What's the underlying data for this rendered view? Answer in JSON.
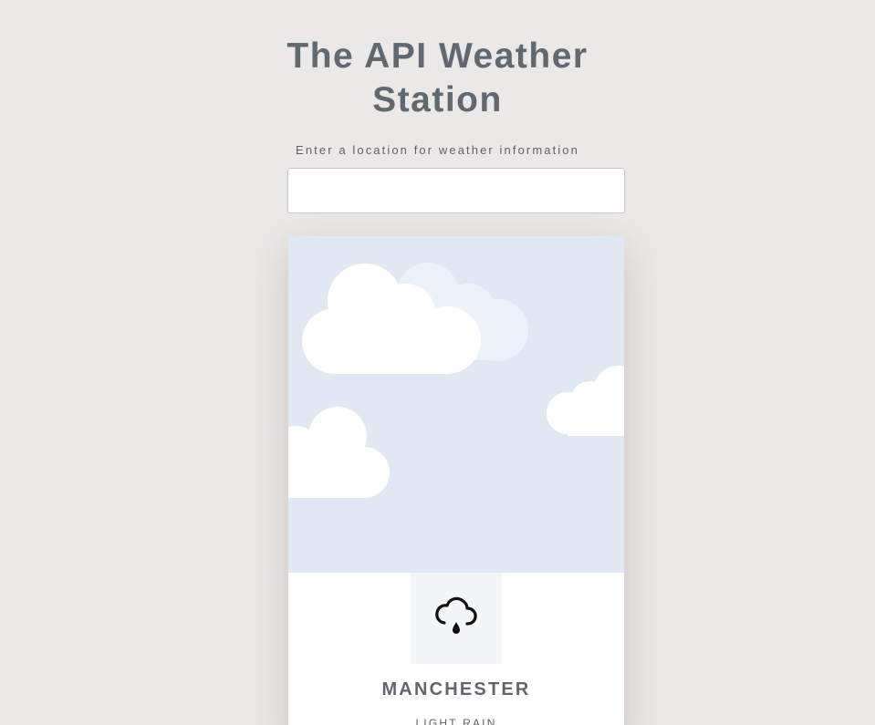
{
  "header": {
    "title_line1": "The API Weather",
    "title_line2": "Station",
    "prompt": "Enter a location for weather information"
  },
  "search": {
    "value": "",
    "placeholder": ""
  },
  "weather_card": {
    "scene": "cloudy-sky",
    "icon": "light-rain-icon",
    "city": "MANCHESTER",
    "condition": "LIGHT RAIN"
  },
  "colors": {
    "page_background": "#ebe9e7",
    "sky_background": "#e0e8f3",
    "cloud": "#ffffff",
    "cloud_faded": "#edf1f9",
    "title_text": "#606870"
  }
}
